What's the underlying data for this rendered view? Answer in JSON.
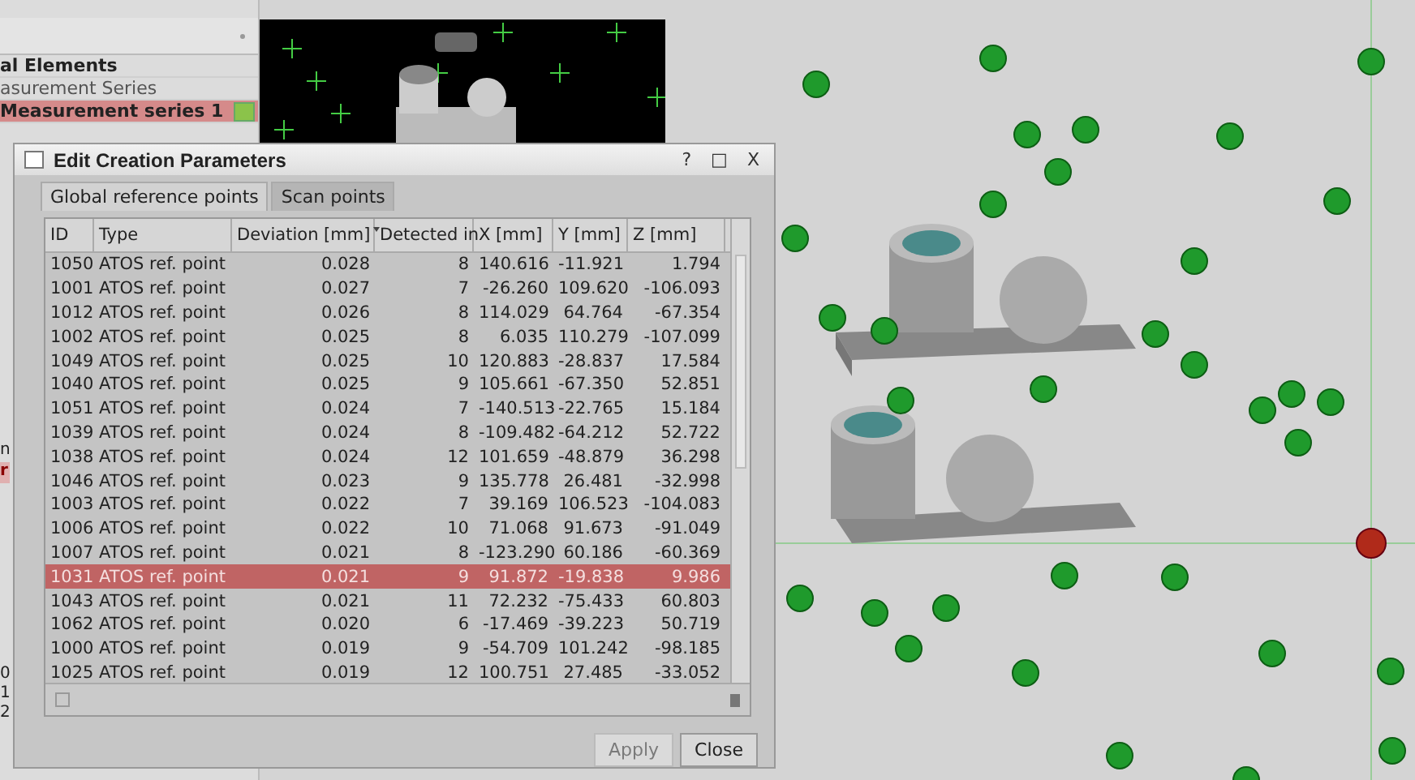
{
  "explorer": {
    "items": [
      {
        "label": "al Elements",
        "kind": "group",
        "selected": false
      },
      {
        "label": "asurement Series",
        "kind": "item",
        "selected": false
      },
      {
        "label": "Measurement series 1",
        "kind": "series",
        "selected": true
      }
    ],
    "fragments": [
      {
        "label": "n",
        "selected": false
      },
      {
        "label": "r",
        "selected": true
      }
    ],
    "numbers": [
      "0",
      "1",
      "2"
    ]
  },
  "dialog": {
    "title": "Edit Creation Parameters",
    "controls": [
      "?",
      "□",
      "X"
    ],
    "tabs": [
      {
        "label": "Global reference points",
        "selected": true
      },
      {
        "label": "Scan points",
        "selected": false
      }
    ],
    "table": {
      "columns": [
        {
          "label": "ID",
          "sorted": false
        },
        {
          "label": "Type",
          "sorted": false
        },
        {
          "label": "Deviation [mm]",
          "sorted": true
        },
        {
          "label": "Detected in",
          "sorted": false
        },
        {
          "label": "X [mm]",
          "sorted": false
        },
        {
          "label": "Y [mm]",
          "sorted": false
        },
        {
          "label": "Z [mm]",
          "sorted": false
        }
      ],
      "rows": [
        {
          "cells": [
            "1050",
            "ATOS ref. point",
            "0.028",
            "8",
            "140.616",
            "-11.921",
            "1.794"
          ],
          "selected": false
        },
        {
          "cells": [
            "1001",
            "ATOS ref. point",
            "0.027",
            "7",
            "-26.260",
            "109.620",
            "-106.093"
          ],
          "selected": false
        },
        {
          "cells": [
            "1012",
            "ATOS ref. point",
            "0.026",
            "8",
            "114.029",
            "64.764",
            "-67.354"
          ],
          "selected": false
        },
        {
          "cells": [
            "1002",
            "ATOS ref. point",
            "0.025",
            "8",
            "6.035",
            "110.279",
            "-107.099"
          ],
          "selected": false
        },
        {
          "cells": [
            "1049",
            "ATOS ref. point",
            "0.025",
            "10",
            "120.883",
            "-28.837",
            "17.584"
          ],
          "selected": false
        },
        {
          "cells": [
            "1040",
            "ATOS ref. point",
            "0.025",
            "9",
            "105.661",
            "-67.350",
            "52.851"
          ],
          "selected": false
        },
        {
          "cells": [
            "1051",
            "ATOS ref. point",
            "0.024",
            "7",
            "-140.513",
            "-22.765",
            "15.184"
          ],
          "selected": false
        },
        {
          "cells": [
            "1039",
            "ATOS ref. point",
            "0.024",
            "8",
            "-109.482",
            "-64.212",
            "52.722"
          ],
          "selected": false
        },
        {
          "cells": [
            "1038",
            "ATOS ref. point",
            "0.024",
            "12",
            "101.659",
            "-48.879",
            "36.298"
          ],
          "selected": false
        },
        {
          "cells": [
            "1046",
            "ATOS ref. point",
            "0.023",
            "9",
            "135.778",
            "26.481",
            "-32.998"
          ],
          "selected": false
        },
        {
          "cells": [
            "1003",
            "ATOS ref. point",
            "0.022",
            "7",
            "39.169",
            "106.523",
            "-104.083"
          ],
          "selected": false
        },
        {
          "cells": [
            "1006",
            "ATOS ref. point",
            "0.022",
            "10",
            "71.068",
            "91.673",
            "-91.049"
          ],
          "selected": false
        },
        {
          "cells": [
            "1007",
            "ATOS ref. point",
            "0.021",
            "8",
            "-123.290",
            "60.186",
            "-60.369"
          ],
          "selected": false
        },
        {
          "cells": [
            "1031",
            "ATOS ref. point",
            "0.021",
            "9",
            "91.872",
            "-19.838",
            "9.986"
          ],
          "selected": true
        },
        {
          "cells": [
            "1043",
            "ATOS ref. point",
            "0.021",
            "11",
            "72.232",
            "-75.433",
            "60.803"
          ],
          "selected": false
        },
        {
          "cells": [
            "1062",
            "ATOS ref. point",
            "0.020",
            "6",
            "-17.469",
            "-39.223",
            "50.719"
          ],
          "selected": false
        },
        {
          "cells": [
            "1000",
            "ATOS ref. point",
            "0.019",
            "9",
            "-54.709",
            "101.242",
            "-98.185"
          ],
          "selected": false
        },
        {
          "cells": [
            "1025",
            "ATOS ref. point",
            "0.019",
            "12",
            "100.751",
            "27.485",
            "-33.052"
          ],
          "selected": false
        }
      ]
    },
    "buttons": [
      {
        "label": "Apply",
        "disabled": true
      },
      {
        "label": "Close",
        "disabled": false
      }
    ]
  }
}
